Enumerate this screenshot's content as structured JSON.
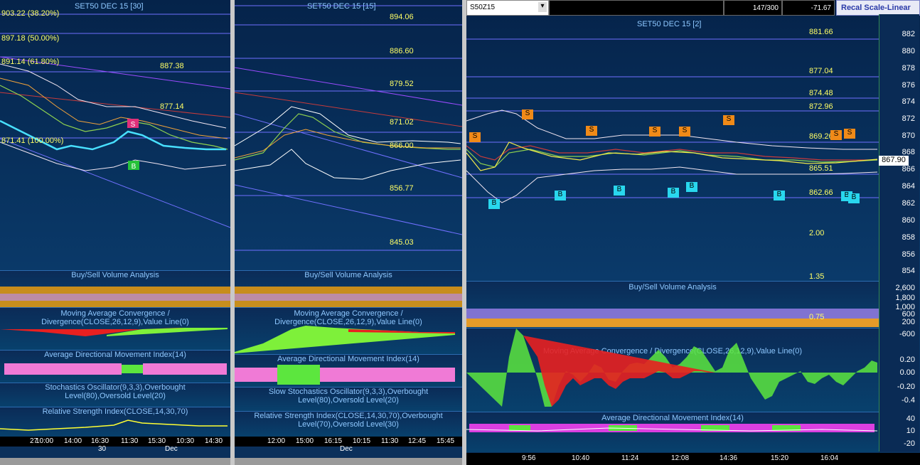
{
  "pane1": {
    "title": "SET50 DEC 15  [30]",
    "levels": [
      "903.22 (38.20%)",
      "897.18 (50.00%)",
      "891.14 (61.80%)",
      "887.38",
      "877.14",
      "871.41 (100.00%)"
    ],
    "signals": [
      "S",
      "B"
    ],
    "indicators": [
      "Buy/Sell Volume Analysis",
      "Moving Average Convergence / Divergence(CLOSE,26,12,9),Value Line(0)",
      "Average Directional Movement Index(14)",
      "Stochastics Oscillator(9,3,3),Overbought Level(80),Oversold Level(20)",
      "Relative Strength Index(CLOSE,14,30,70)"
    ],
    "times": [
      "27",
      "10:00",
      "14:00",
      "16:30",
      "30",
      "11:30",
      "15:30",
      "Dec",
      "10:30",
      "14:30"
    ]
  },
  "pane2": {
    "title": "SET50 DEC 15  [15]",
    "levels": [
      "894.06",
      "886.60",
      "879.52",
      "871.02",
      "866.00",
      "856.77",
      "845.03"
    ],
    "indicators": [
      "Buy/Sell Volume Analysis",
      "Moving Average Convergence / Divergence(CLOSE,26,12,9),Value Line(0)",
      "Average Directional Movement Index(14)",
      "Slow Stochastics Oscillator(9,3,3),Overbought Level(80),Oversold Level(20)",
      "Relative Strength Index(CLOSE,14,30,70),Overbought Level(70),Oversold Level(30)"
    ],
    "times": [
      "12:00",
      "15:00",
      "16:15",
      "10:15",
      "11:30",
      "12:45",
      "15:45",
      "Dec"
    ]
  },
  "pane3": {
    "symbol": "S50Z15",
    "position": "147/300",
    "change": "-71.67",
    "recal_label": "Recal Scale-Linear",
    "title": "SET50 DEC 15  [2]",
    "levels": [
      "881.66",
      "877.04",
      "874.48",
      "872.96",
      "869.26",
      "865.51",
      "862.66",
      "2.00",
      "1.35",
      "0.75"
    ],
    "last_price": "867.90",
    "price_axis": [
      "882",
      "880",
      "878",
      "876",
      "874",
      "872",
      "870",
      "868",
      "866",
      "864",
      "862",
      "860",
      "858",
      "856",
      "854"
    ],
    "vol_axis": [
      "2,600",
      "1,800",
      "1,000",
      "600",
      "200"
    ],
    "macd_axis": [
      "-600",
      "0.20",
      "0.00",
      "-0.20",
      "-0.4"
    ],
    "adx_axis": [
      "40",
      "10",
      "-20"
    ],
    "indicators": [
      "Buy/Sell Volume Analysis",
      "Moving Average Convergence / Divergence(CLOSE,26,12,9),Value Line(0)",
      "Average Directional Movement Index(14)"
    ],
    "times": [
      "9:56",
      "10:40",
      "11:24",
      "12:08",
      "14:36",
      "15:20",
      "16:04"
    ],
    "sells": [
      "S",
      "S",
      "S",
      "S",
      "S",
      "S",
      "S",
      "S"
    ],
    "buys": [
      "B",
      "B",
      "B",
      "B",
      "B",
      "B",
      "B",
      "B"
    ]
  }
}
